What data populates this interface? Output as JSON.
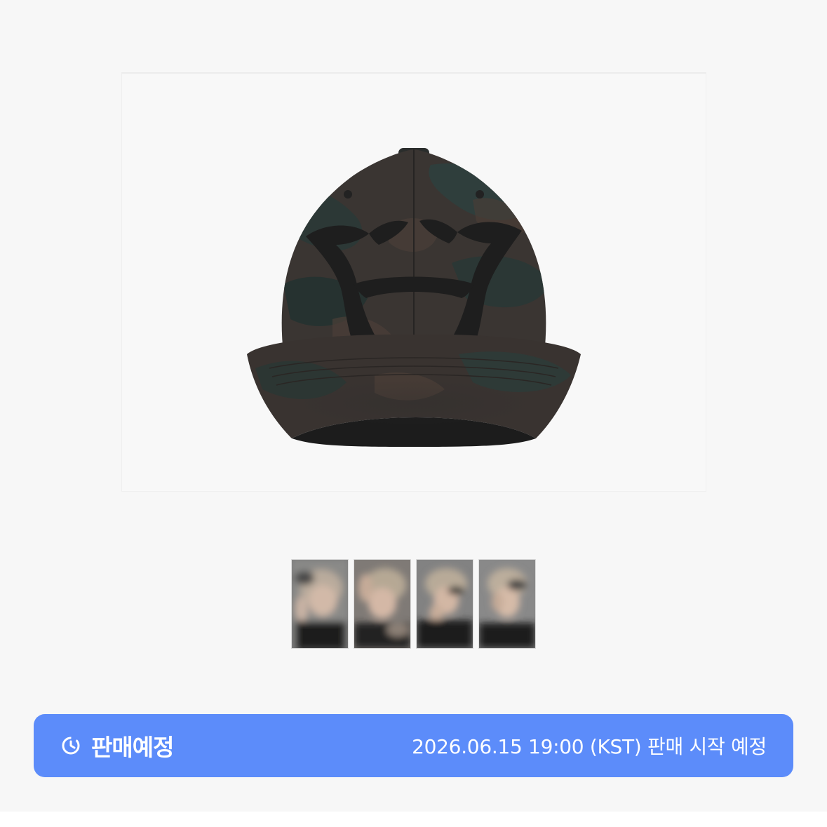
{
  "product": {
    "image_alt": "camouflage baseball cap",
    "thumbnails": [
      {
        "alt": "photocard-1"
      },
      {
        "alt": "photocard-2"
      },
      {
        "alt": "photocard-3"
      },
      {
        "alt": "photocard-4"
      }
    ]
  },
  "status": {
    "icon": "clock-icon",
    "label": "판매예정",
    "detail": "2026.06.15 19:00 (KST) 판매 시작 예정",
    "color": "#5c8cfa"
  }
}
